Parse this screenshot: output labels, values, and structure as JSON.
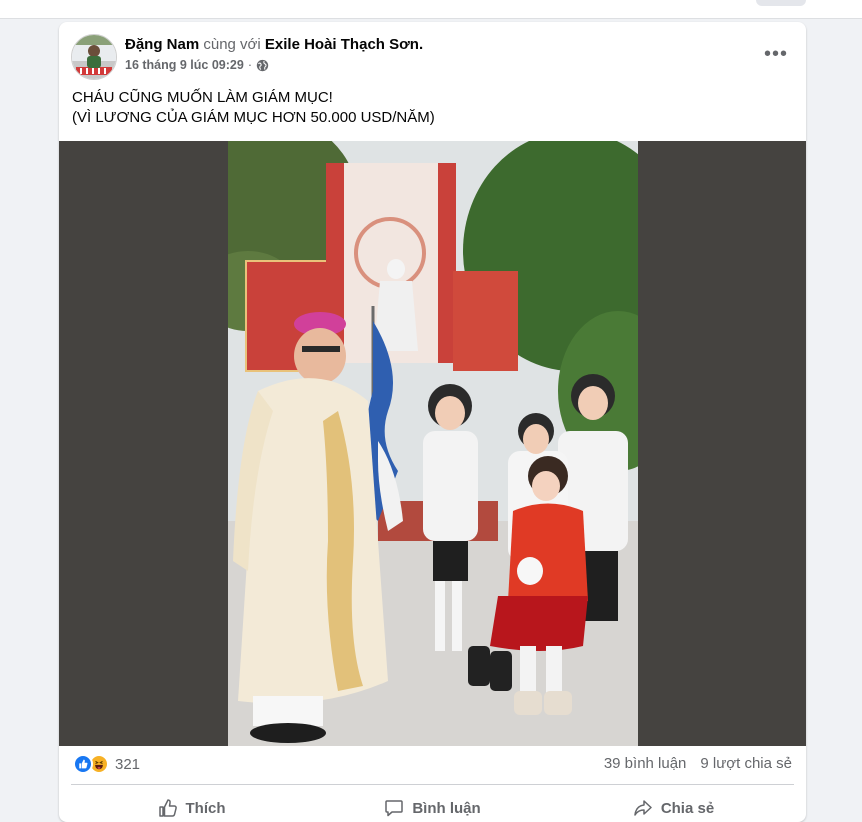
{
  "post": {
    "author": "Đặng Nam",
    "with_text": "cùng với",
    "tagged": "Exile Hoài Thạch Sơn.",
    "timestamp": "16 tháng 9 lúc 09:29",
    "separator": "·",
    "privacy_icon": "globe-icon",
    "more_icon": "more-options-icon",
    "text_lines": [
      "CHÁU CŨNG MUỐN LÀM GIÁM MỤC!",
      "(VÌ LƯƠNG CỦA GIÁM MỤC HƠN 50.000 USD/NĂM)"
    ]
  },
  "stats": {
    "reaction_icons": [
      "like-icon",
      "haha-icon"
    ],
    "reaction_count": "321",
    "comments": "39 bình luận",
    "shares": "9 lượt chia sẻ"
  },
  "actions": {
    "like": "Thích",
    "comment": "Bình luận",
    "share": "Chia sẻ"
  },
  "colors": {
    "page_bg": "#f0f2f5",
    "card_bg": "#ffffff",
    "media_bg": "#454340",
    "muted_text": "#65676b",
    "like_blue": "#1877f2",
    "haha_yellow": "#f7b125"
  }
}
